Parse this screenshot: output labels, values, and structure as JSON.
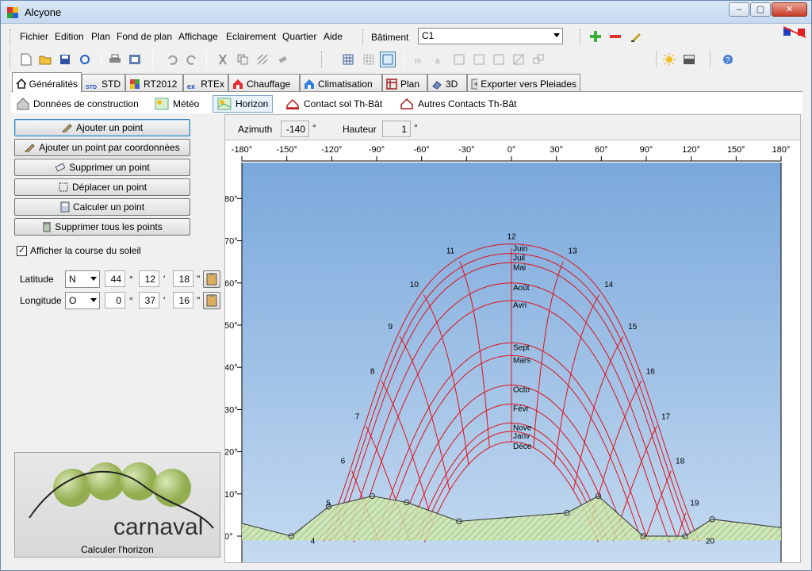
{
  "window": {
    "title": "Alcyone",
    "min": "–",
    "max": "▢",
    "close": "✕"
  },
  "menu": [
    "Fichier",
    "Edition",
    "Plan",
    "Fond de plan",
    "Affichage",
    "Eclairement",
    "Quartier",
    "Aide"
  ],
  "building": {
    "label": "Bâtiment",
    "value": "C1"
  },
  "tabs": [
    {
      "label": "Généralités",
      "icon": "house-icon"
    },
    {
      "label": "STD",
      "icon": "std-icon"
    },
    {
      "label": "RT2012",
      "icon": "rt2012-icon"
    },
    {
      "label": "RTEx",
      "icon": "rtex-icon"
    },
    {
      "label": "Chauffage",
      "icon": "heating-icon"
    },
    {
      "label": "Climatisation",
      "icon": "cooling-icon"
    },
    {
      "label": "Plan",
      "icon": "plan-icon"
    },
    {
      "label": "3D",
      "icon": "3d-icon"
    },
    {
      "label": "Exporter vers Pleiades",
      "icon": "export-icon"
    }
  ],
  "subtabs": [
    {
      "label": "Données de construction",
      "icon": "house-icon"
    },
    {
      "label": "Météo",
      "icon": "weather-icon"
    },
    {
      "label": "Horizon",
      "icon": "horizon-icon"
    },
    {
      "label": "Contact sol Th-Bât",
      "icon": "ground-contact-icon"
    },
    {
      "label": "Autres Contacts Th-Bât",
      "icon": "other-contacts-icon"
    }
  ],
  "actions": [
    "Ajouter un point",
    "Ajouter un point par coordonnées",
    "Supprimer un point",
    "Déplacer un point",
    "Calculer un point",
    "Supprimer tous les points"
  ],
  "sun_path_checkbox": {
    "label": "Afficher la course du soleil",
    "checked": true
  },
  "latitude": {
    "label": "Latitude",
    "hemisphere": "N",
    "deg": "44",
    "min": "12",
    "sec": "18"
  },
  "longitude": {
    "label": "Longitude",
    "hemisphere": "O",
    "deg": "0",
    "min": "37",
    "sec": "16"
  },
  "units": {
    "deg": "°",
    "min": "'",
    "sec": "\""
  },
  "logo": {
    "text": "carnaval",
    "caption": "Calculer l'horizon"
  },
  "azimuth_bar": {
    "az_label": "Azimuth",
    "az_value": "-140",
    "h_label": "Hauteur",
    "h_value": "1",
    "unit": "°"
  },
  "chart_data": {
    "type": "line",
    "x_ticks": [
      "-180°",
      "-150°",
      "-120°",
      "-90°",
      "-60°",
      "-30°",
      "0°",
      "30°",
      "60°",
      "90°",
      "120°",
      "150°",
      "180°"
    ],
    "y_ticks": [
      "0°",
      "10°",
      "20°",
      "30°",
      "40°",
      "50°",
      "60°",
      "70°",
      "80°"
    ],
    "xlim": [
      -180,
      180
    ],
    "ylim": [
      -1,
      89
    ],
    "hours": [
      "4",
      "5",
      "6",
      "7",
      "8",
      "9",
      "10",
      "11",
      "12",
      "13",
      "14",
      "15",
      "16",
      "17",
      "18",
      "19",
      "20"
    ],
    "months": [
      "Juin",
      "Juil",
      "Mai",
      "Août",
      "Avri",
      "Sept",
      "Mars",
      "Octo",
      "Févr",
      "Nove",
      "Janv",
      "Déce"
    ],
    "horizon_points": [
      [
        -180,
        3
      ],
      [
        -147,
        0
      ],
      [
        -122,
        7
      ],
      [
        -93,
        9.5
      ],
      [
        -70,
        8
      ],
      [
        -35,
        3.5
      ],
      [
        37,
        5.5
      ],
      [
        58,
        9.5
      ],
      [
        88,
        0
      ],
      [
        116,
        0
      ],
      [
        134,
        4
      ],
      [
        180,
        2
      ]
    ],
    "colors": {
      "sun_path": "#e0101a",
      "horizon_fill": "#b4d890",
      "sky_top": "#7aa8dc",
      "sky_bottom": "#c4daf0"
    }
  }
}
